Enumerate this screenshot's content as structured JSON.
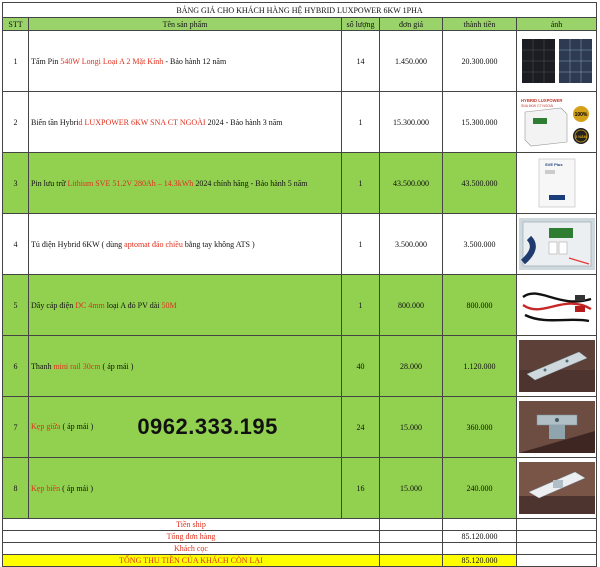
{
  "title": "BẢNG GIÁ CHO KHÁCH HÀNG HỆ HYBRID LUXPOWER 6KW 1PHA",
  "headers": {
    "stt": "STT",
    "product": "Tên sản phẩm",
    "qty": "số lượng",
    "unit_price": "đơn giá",
    "total": "thành tiền",
    "image": "ảnh"
  },
  "rows": [
    {
      "stt": "1",
      "name_a": "Tấm Pin ",
      "name_red": "540W Longi Loại A 2 Mặt Kính",
      "name_b": " - Bảo hành 12 năm",
      "qty": "14",
      "price": "1.450.000",
      "total": "20.300.000",
      "image_icon": "solar-panel-photo"
    },
    {
      "stt": "2",
      "name_a": "Biến tần Hybri",
      "name_red": "d LUXPOWER 6KW SNA CT NGOÀI",
      "name_b": " 2024 - Bảo hành 3 năm",
      "qty": "1",
      "price": "15.300.000",
      "total": "15.300.000",
      "image_icon": "inverter-photo",
      "image_text": [
        "HYBRID LUXPOWER",
        "SNA 6KW CT NGOÀI",
        "100%",
        "3 NĂM"
      ]
    },
    {
      "stt": "3",
      "name_a": "Pin lưu trữ ",
      "name_red": "Lithium SVE 51.2V 280Ah – 14.3kWh",
      "name_b": " 2024 chính hãng - Bảo hành 5 năm",
      "qty": "1",
      "price": "43.500.000",
      "total": "43.500.000",
      "image_icon": "battery-photo",
      "image_text": [
        "SVE Plus"
      ]
    },
    {
      "stt": "4",
      "name_a": "Tủ điện Hybrid 6KW ( dùng ",
      "name_red": "aptomat đảo chiều",
      "name_b": " bằng tay không ATS )",
      "qty": "1",
      "price": "3.500.000",
      "total": "3.500.000",
      "image_icon": "electrical-cabinet-photo"
    },
    {
      "stt": "5",
      "name_a": "Dây cáp điện ",
      "name_red": "DC 4mm",
      "name_b": " loại A đỏ PV dài ",
      "name_red2": "50M",
      "qty": "1",
      "price": "800.000",
      "total": "800.000",
      "image_icon": "cable-photo"
    },
    {
      "stt": "6",
      "name_a": "Thanh ",
      "name_red": "mini rail 30cm",
      "name_b": " ( áp mái )",
      "qty": "40",
      "price": "28.000",
      "total": "1.120.000",
      "image_icon": "mini-rail-photo"
    },
    {
      "stt": "7",
      "name_a": "",
      "name_red": "Kẹp giữa",
      "name_b": " ( áp mái )",
      "phone": "0962.333.195",
      "qty": "24",
      "price": "15.000",
      "total": "360.000",
      "image_icon": "mid-clamp-photo"
    },
    {
      "stt": "8",
      "name_a": "",
      "name_red": "Kẹp biên",
      "name_b": " ( áp mái )",
      "qty": "16",
      "price": "15.000",
      "total": "240.000",
      "image_icon": "end-clamp-photo"
    }
  ],
  "footer": {
    "shipping_label": "Tiền ship",
    "shipping_value": "",
    "order_total_label": "Tổng đơn hàng",
    "order_total_value": "85.120.000",
    "deposit_label": "Khách cọc",
    "deposit_value": "",
    "remaining_label": "TỔNG THU TIỀN CỦA KHÁCH CÒN LẠI",
    "remaining_value": "85.120.000"
  },
  "colors": {
    "highlight_green": "#92d050",
    "header_green": "#9bd36b",
    "red_text": "#e0301e",
    "yellow": "#ffff00"
  }
}
